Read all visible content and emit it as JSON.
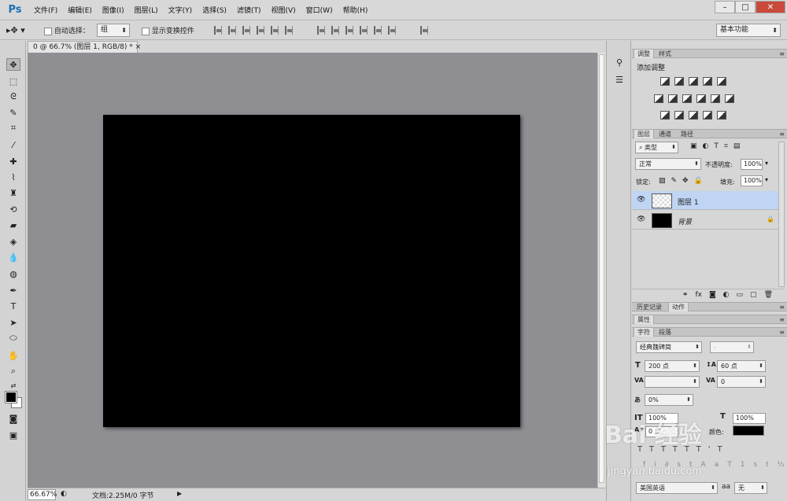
{
  "app": {
    "logo": "Ps"
  },
  "menu": [
    "文件(F)",
    "编辑(E)",
    "图像(I)",
    "图层(L)",
    "文字(Y)",
    "选择(S)",
    "滤镜(T)",
    "视图(V)",
    "窗口(W)",
    "帮助(H)"
  ],
  "window_controls": {
    "minimize": "–",
    "restore": "□",
    "close": "✕"
  },
  "options": {
    "auto_select_label": "自动选择：",
    "auto_select_value": "组",
    "show_transform_label": "显示变换控件",
    "workspace": "基本功能"
  },
  "document": {
    "tab_title": "0 @ 66.7% (图层 1, RGB/8) *",
    "zoom": "66.67%",
    "status": "文档:2.25M/0 字节"
  },
  "adjustments": {
    "tabs": [
      "调整",
      "样式"
    ],
    "title": "添加调整"
  },
  "layers": {
    "tabs": [
      "图层",
      "通道",
      "路径"
    ],
    "filter_kind": "类型",
    "blend_mode": "正常",
    "opacity_label": "不透明度:",
    "opacity_value": "100%",
    "lock_label": "锁定:",
    "fill_label": "填充:",
    "fill_value": "100%",
    "items": [
      {
        "name": "图层 1",
        "selected": true
      },
      {
        "name": "背景",
        "selected": false,
        "locked": true
      }
    ]
  },
  "history": {
    "tabs": [
      "历史记录",
      "动作"
    ]
  },
  "properties": {
    "title": "属性"
  },
  "character": {
    "tabs": [
      "字符",
      "段落"
    ],
    "font_family": "经典魏碑简",
    "font_style": "-",
    "font_size": "200 点",
    "leading": "60 点",
    "kerning": "",
    "tracking": "0",
    "baseline": "0%",
    "vscale": "100%",
    "hscale": "100%",
    "baseline_shift": "0 点",
    "color_label": "颜色:",
    "color": "#000000",
    "language": "美国英语",
    "aa_label": "aa",
    "antialias": "无"
  },
  "watermark": {
    "main": "Bai 经验",
    "sub": "jingyan.baidu.com"
  }
}
